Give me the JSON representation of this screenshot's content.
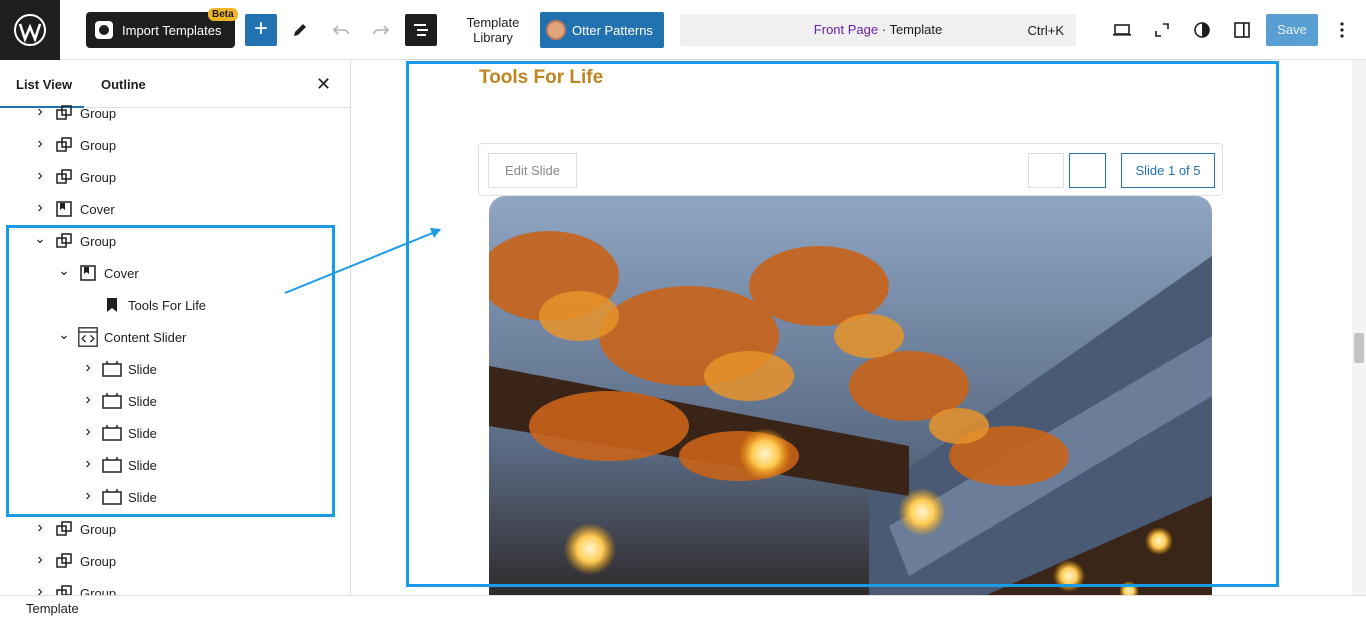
{
  "toolbar": {
    "import_label": "Import Templates",
    "beta_badge": "Beta",
    "add_symbol": "+",
    "template_library_line1": "Template",
    "template_library_line2": "Library",
    "otter_label": "Otter Patterns",
    "command_bar": {
      "page": "Front Page",
      "separator": " · ",
      "type": "Template",
      "shortcut": "Ctrl+K"
    },
    "save_label": "Save"
  },
  "sidebar": {
    "tabs": [
      "List View",
      "Outline"
    ],
    "close_symbol": "✕",
    "tree": [
      {
        "label": "Group",
        "icon": "group-icon",
        "level": 0,
        "chevron": "right"
      },
      {
        "label": "Group",
        "icon": "group-icon",
        "level": 0,
        "chevron": "right"
      },
      {
        "label": "Group",
        "icon": "group-icon",
        "level": 0,
        "chevron": "right"
      },
      {
        "label": "Cover",
        "icon": "cover-icon",
        "level": 0,
        "chevron": "right"
      },
      {
        "label": "Group",
        "icon": "group-icon",
        "level": 0,
        "chevron": "down"
      },
      {
        "label": "Cover",
        "icon": "cover-icon",
        "level": 1,
        "chevron": "down"
      },
      {
        "label": "Tools For Life",
        "icon": "bookmark-icon",
        "level": 2,
        "chevron": ""
      },
      {
        "label": "Content Slider",
        "icon": "code-slider-icon",
        "level": 1,
        "chevron": "down"
      },
      {
        "label": "Slide",
        "icon": "slide-icon",
        "level": 2,
        "chevron": "right"
      },
      {
        "label": "Slide",
        "icon": "slide-icon",
        "level": 2,
        "chevron": "right"
      },
      {
        "label": "Slide",
        "icon": "slide-icon",
        "level": 2,
        "chevron": "right"
      },
      {
        "label": "Slide",
        "icon": "slide-icon",
        "level": 2,
        "chevron": "right"
      },
      {
        "label": "Slide",
        "icon": "slide-icon",
        "level": 2,
        "chevron": "right"
      },
      {
        "label": "Group",
        "icon": "group-icon",
        "level": 0,
        "chevron": "right"
      },
      {
        "label": "Group",
        "icon": "group-icon",
        "level": 0,
        "chevron": "right"
      },
      {
        "label": "Group",
        "icon": "group-icon",
        "level": 0,
        "chevron": "right"
      }
    ]
  },
  "canvas": {
    "heading": "Tools For Life",
    "edit_slide": "Edit Slide",
    "slide_count": "Slide 1 of 5"
  },
  "footer": {
    "breadcrumb": "Template"
  },
  "colors": {
    "accent": "#2271b1",
    "highlight": "#1a9be8",
    "heading": "#c08420"
  }
}
